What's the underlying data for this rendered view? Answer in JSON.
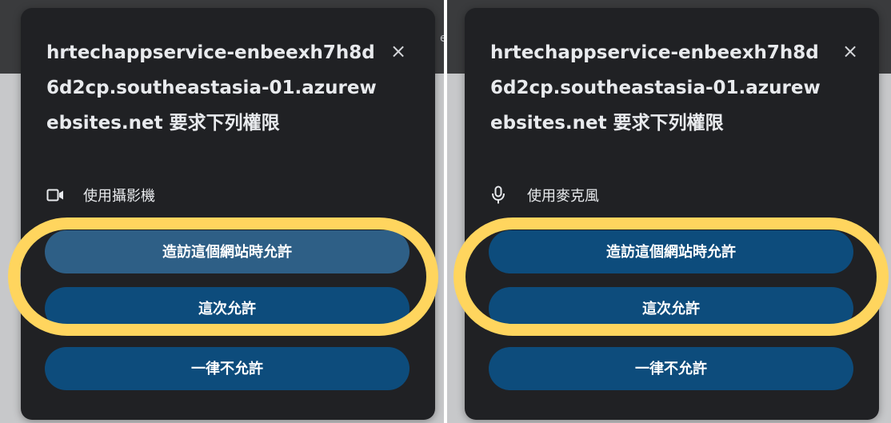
{
  "panels": [
    {
      "id": "camera",
      "peek_text": "e",
      "dialog": {
        "title": "hrtechappservice-enbeexh7h8d6d2cp.southeastasia-01.azurewebsites.net 要求下列權限",
        "close_icon": "×",
        "permission": {
          "icon": "video-camera-icon",
          "label": "使用攝影機"
        },
        "buttons": {
          "allow_on_visit": "造訪這個網站時允許",
          "allow_this_time": "這次允許",
          "never_allow": "一律不允許"
        }
      },
      "highlight_color": "#ffd55e"
    },
    {
      "id": "microphone",
      "peek_text": "",
      "dialog": {
        "title": "hrtechappservice-enbeexh7h8d6d2cp.southeastasia-01.azurewebsites.net 要求下列權限",
        "close_icon": "×",
        "permission": {
          "icon": "microphone-icon",
          "label": "使用麥克風"
        },
        "buttons": {
          "allow_on_visit": "造訪這個網站時允許",
          "allow_this_time": "這次允許",
          "never_allow": "一律不允許"
        }
      },
      "highlight_color": "#ffd55e"
    }
  ],
  "colors": {
    "dialog_bg": "#202124",
    "button_bg": "#0d4c7c",
    "text": "#e8eaed"
  }
}
